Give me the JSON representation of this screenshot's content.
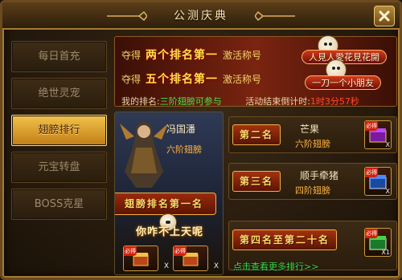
{
  "window": {
    "title": "公测庆典"
  },
  "sidebar": {
    "items": [
      {
        "label": "每日首充",
        "active": false
      },
      {
        "label": "绝世灵宠",
        "active": false
      },
      {
        "label": "翅膀排行",
        "active": true
      },
      {
        "label": "元宝转盘",
        "active": false
      },
      {
        "label": "BOSS克星",
        "active": false
      }
    ]
  },
  "banner": {
    "line1": {
      "pre": "夺得",
      "big": "两个排名第一",
      "post": "激活称号",
      "badge": "人見人愛花見花開"
    },
    "line2": {
      "pre": "夺得",
      "big": "五个排名第一",
      "post": "激活称号",
      "badge": "一刀一个小朋友"
    },
    "my_rank_label": "我的排名:",
    "my_rank_value": "三阶翅膀可参与",
    "countdown_label": "活动结束倒计时:",
    "countdown_value": "1时3分57秒"
  },
  "hero": {
    "name": "冯国潘",
    "wing": "六阶翅膀",
    "rank_ribbon": "翅膀排名第一名",
    "slogan": "你咋不上天呢",
    "rewards": [
      {
        "count": "X"
      },
      {
        "count": "X"
      }
    ]
  },
  "ranks": [
    {
      "tag": "第二名",
      "name": "芒果",
      "wing": "六阶翅膀",
      "count": "X"
    },
    {
      "tag": "第三名",
      "name": "顺手牵猪",
      "wing": "四阶翅膀",
      "count": "X"
    },
    {
      "tag": "第四名至第二十名",
      "name": "",
      "wing": "",
      "count": "X1"
    }
  ],
  "reward_tag": "必得",
  "more_link": "点击查看更多排行>>",
  "colors": {
    "accent_gold": "#f2c24c",
    "green_text": "#4ee04e",
    "red_text": "#ff4a2a",
    "wing_orange": "#ffb340"
  }
}
